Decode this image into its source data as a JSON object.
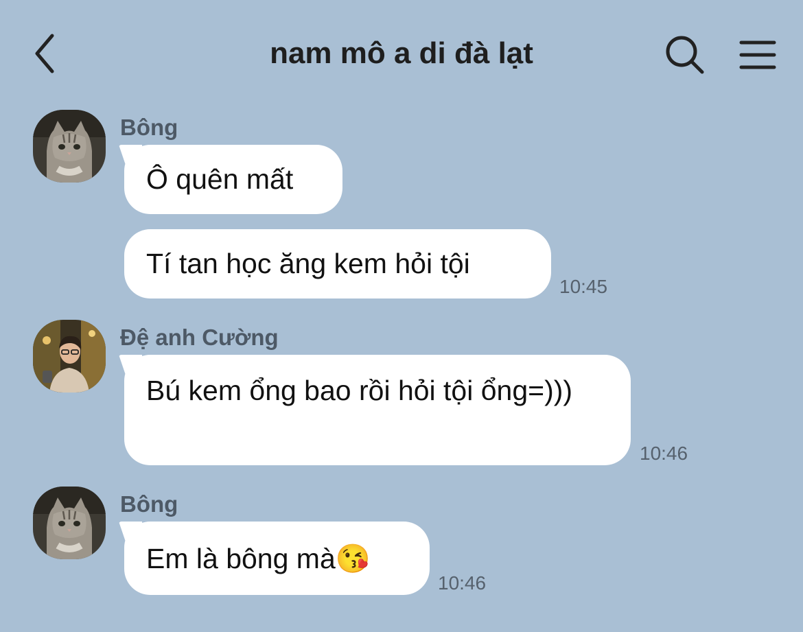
{
  "header": {
    "title": "nam mô a di đà lạt",
    "back_icon": "chevron-left-icon",
    "search_icon": "search-icon",
    "menu_icon": "hamburger-menu-icon"
  },
  "colors": {
    "background": "#a9bfd4",
    "bubble": "#ffffff",
    "sender_name": "#4d5966",
    "timestamp": "#56616d"
  },
  "messages": [
    {
      "sender": "Bông",
      "avatar": "cat-avatar",
      "bubbles": [
        {
          "text": "Ô quên mất",
          "time": ""
        },
        {
          "text": "Tí tan học ăng kem hỏi tội",
          "time": "10:45"
        }
      ]
    },
    {
      "sender": "Đệ anh Cường",
      "avatar": "person-avatar",
      "bubbles": [
        {
          "text": "Bú kem ổng bao rồi hỏi tội ổng=)))",
          "time": "10:46"
        }
      ]
    },
    {
      "sender": "Bông",
      "avatar": "cat-avatar",
      "bubbles": [
        {
          "text": "Em là bông mà😘",
          "time": "10:46"
        }
      ]
    }
  ]
}
